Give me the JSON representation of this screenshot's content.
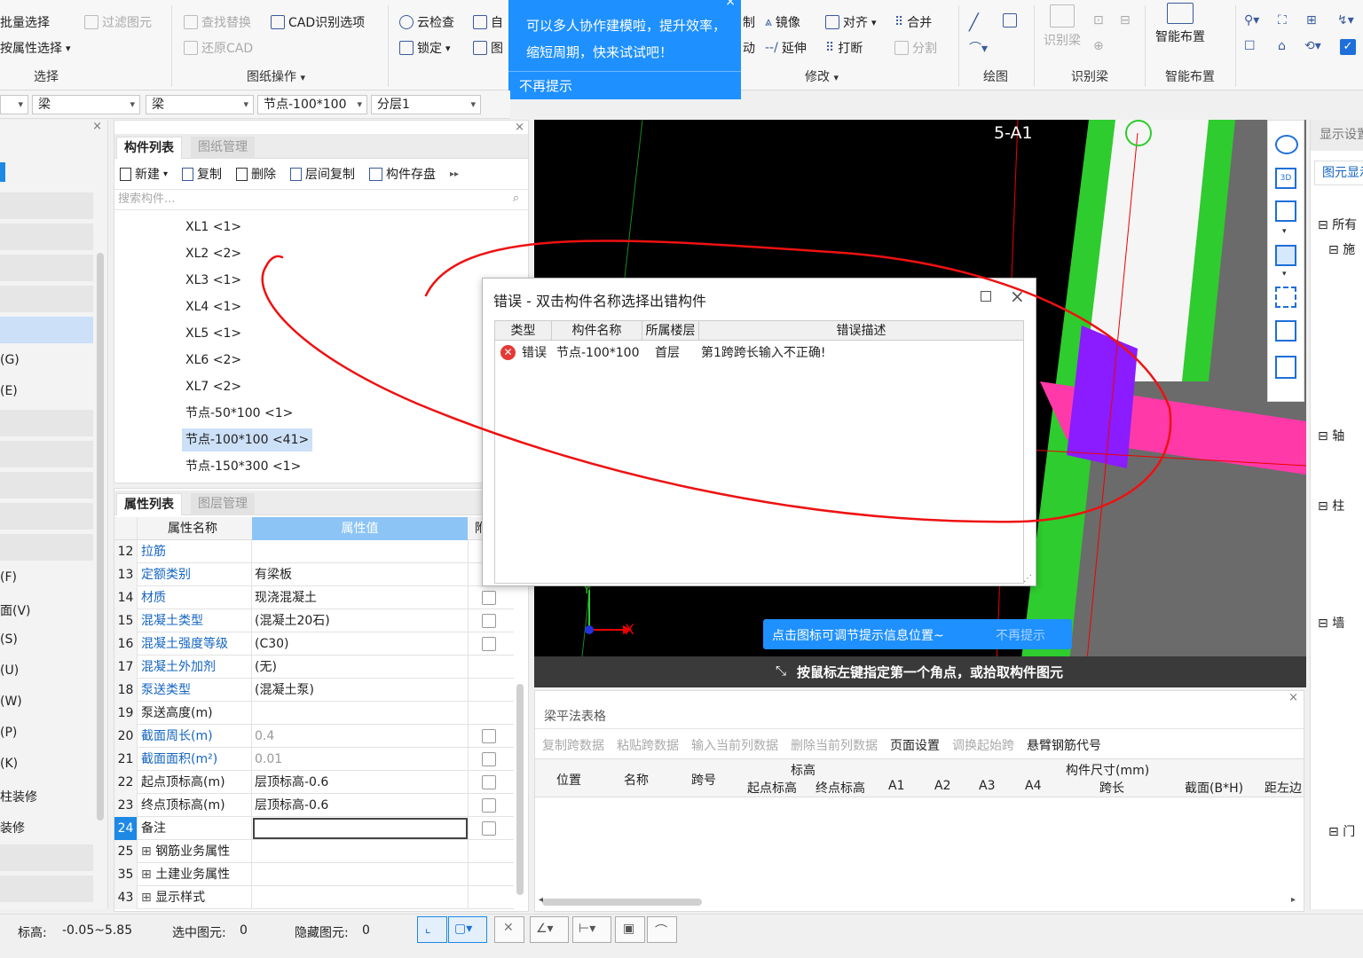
{
  "ribbon": {
    "select_group": {
      "batch_select": "批量选择",
      "filter": "过滤图元",
      "attr_select": "按属性选择",
      "label": "选择"
    },
    "drawing_ops": {
      "find_replace": "查找替换",
      "cad_options": "CAD识别选项",
      "restore_cad": "还原CAD",
      "label": "图纸操作"
    },
    "check_group": {
      "cloud_check": "云检查",
      "lock": "锁定"
    },
    "modify_group": {
      "mirror": "镜像",
      "align": "对齐",
      "merge": "合并",
      "extend": "延伸",
      "break": "打断",
      "split": "分割",
      "label": "修改"
    },
    "draw_label": "绘图",
    "identify_beam": {
      "label": "识别梁",
      "btn": "识别梁"
    },
    "smart_layout": {
      "btn": "智能布置",
      "label": "智能布置"
    }
  },
  "tooltip_top": {
    "text": "可以多人协作建模啦，提升效率，缩短周期，快来试试吧！",
    "dismiss": "不再提示"
  },
  "selectors": [
    "梁",
    "梁",
    "节点-100*100",
    "分层1"
  ],
  "left_labels": [
    "(G)",
    "(E)",
    "(F)",
    "面(V)",
    "(S)",
    "(U)",
    "(W)",
    "(P)",
    "(K)",
    "柱装修",
    "装修"
  ],
  "component_panel": {
    "tab_active": "构件列表",
    "tab_inactive": "图纸管理",
    "tools": [
      "新建",
      "复制",
      "删除",
      "层间复制",
      "构件存盘"
    ],
    "search_placeholder": "搜索构件...",
    "items": [
      "XL1 <1>",
      "XL2 <2>",
      "XL3 <1>",
      "XL4 <1>",
      "XL5 <1>",
      "XL6 <2>",
      "XL7 <2>",
      "节点-50*100 <1>",
      "节点-100*100 <41>",
      "节点-150*300 <1>"
    ]
  },
  "property_panel": {
    "tab_active": "属性列表",
    "tab_inactive": "图层管理",
    "col_name": "属性名称",
    "col_value": "属性值",
    "col_extra": "附",
    "rows": [
      {
        "num": "12",
        "name": "拉筋",
        "value": "",
        "link": true,
        "chk": false
      },
      {
        "num": "13",
        "name": "定额类别",
        "value": "有梁板",
        "link": true,
        "chk": false
      },
      {
        "num": "14",
        "name": "材质",
        "value": "现浇混凝土",
        "link": true,
        "chk": true
      },
      {
        "num": "15",
        "name": "混凝土类型",
        "value": "(混凝土20石)",
        "link": true,
        "chk": true
      },
      {
        "num": "16",
        "name": "混凝土强度等级",
        "value": "(C30)",
        "link": true,
        "chk": true
      },
      {
        "num": "17",
        "name": "混凝土外加剂",
        "value": "(无)",
        "link": true,
        "chk": false
      },
      {
        "num": "18",
        "name": "泵送类型",
        "value": "(混凝土泵)",
        "link": true,
        "chk": false
      },
      {
        "num": "19",
        "name": "泵送高度(m)",
        "value": "",
        "link": false,
        "chk": false
      },
      {
        "num": "20",
        "name": "截面周长(m)",
        "value": "0.4",
        "link": true,
        "chk": true
      },
      {
        "num": "21",
        "name": "截面面积(m²)",
        "value": "0.01",
        "link": true,
        "chk": true
      },
      {
        "num": "22",
        "name": "起点顶标高(m)",
        "value": "层顶标高-0.6",
        "link": false,
        "chk": true
      },
      {
        "num": "23",
        "name": "终点顶标高(m)",
        "value": "层顶标高-0.6",
        "link": false,
        "chk": true
      },
      {
        "num": "24",
        "name": "备注",
        "value": "",
        "link": false,
        "chk": true
      },
      {
        "num": "25",
        "name": "钢筋业务属性",
        "value": "",
        "link": false,
        "chk": false
      },
      {
        "num": "35",
        "name": "土建业务属性",
        "value": "",
        "link": false,
        "chk": false
      },
      {
        "num": "43",
        "name": "显示样式",
        "value": "",
        "link": false,
        "chk": false
      }
    ]
  },
  "canvas": {
    "axis_label": "5-A1",
    "x_label": "X",
    "y_label": "Y",
    "hint_tip": "点击图标可调节提示信息位置~",
    "hint_dismiss": "不再提示",
    "command_prompt": "按鼠标左键指定第一个角点，或拾取构件图元"
  },
  "error_dialog": {
    "title": "错误 - 双击构件名称选择出错构件",
    "headers": [
      "类型",
      "构件名称",
      "所属楼层",
      "错误描述"
    ],
    "rows": [
      {
        "type": "错误",
        "name": "节点-100*100",
        "floor": "首层",
        "desc": "第1跨跨长输入不正确!"
      }
    ]
  },
  "beam_table": {
    "title": "梁平法表格",
    "tools": [
      "复制跨数据",
      "粘贴跨数据",
      "输入当前列数据",
      "删除当前列数据",
      "页面设置",
      "调换起始跨",
      "悬臂钢筋代号"
    ],
    "headers": {
      "pos": "位置",
      "name": "名称",
      "span": "跨号",
      "elev": "标高",
      "start_elev": "起点标高",
      "end_elev": "终点标高",
      "size": "构件尺寸(mm)",
      "a1": "A1",
      "a2": "A2",
      "a3": "A3",
      "a4": "A4",
      "span_len": "跨长",
      "section": "截面(B*H)",
      "dist": "距左边"
    }
  },
  "right_panel": {
    "title": "显示设置",
    "tab": "图元显示",
    "items": [
      "所有",
      "施",
      "轴",
      "柱",
      "墙",
      "门"
    ]
  },
  "status": {
    "elevation_label": "标高:",
    "elevation": "-0.05~5.85",
    "selected_label": "选中图元:",
    "selected": "0",
    "hidden_label": "隐藏图元:",
    "hidden": "0"
  }
}
